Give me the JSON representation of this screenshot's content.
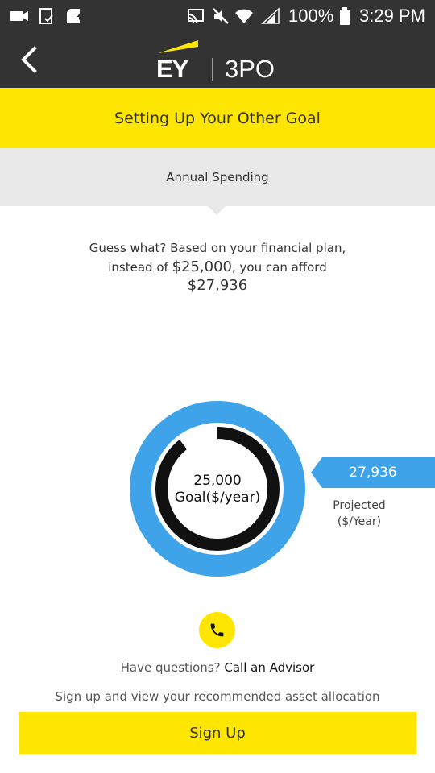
{
  "status_bar": {
    "battery": "100%",
    "time": "3:29 PM",
    "icons": [
      "video-camera-icon",
      "screenshot-icon",
      "sd-card-icon",
      "cast-icon",
      "mute-icon",
      "wifi-icon",
      "signal-icon",
      "battery-icon"
    ]
  },
  "app_bar": {
    "logo_brand": "EY",
    "logo_product": "3PO",
    "back_icon": "chevron-left-icon"
  },
  "colors": {
    "brand_yellow": "#ffe600",
    "dark": "#333333",
    "accent_blue": "#3fa3ea",
    "tab_grey": "#e8e8e8"
  },
  "banner": {
    "title": "Setting Up Your Other Goal"
  },
  "tab": {
    "label": "Annual Spending"
  },
  "message": {
    "line1": "Guess what? Based on your financial plan,",
    "line2_prefix": "instead of",
    "line2_amount": "$25,000",
    "line2_suffix": ", you can afford",
    "amount": "$27,936"
  },
  "gauge": {
    "goal_value": "25,000",
    "goal_label": "Goal($/year)",
    "projected_value": "27,936",
    "projected_label_line1": "Projected",
    "projected_label_line2": "($/Year)",
    "goal_fraction_of_projected": 0.895
  },
  "advisor": {
    "question": "Have questions?",
    "link": "Call an Advisor",
    "icon": "phone-icon"
  },
  "signup": {
    "prompt": "Sign up and view your recommended asset allocation",
    "button": "Sign Up"
  }
}
